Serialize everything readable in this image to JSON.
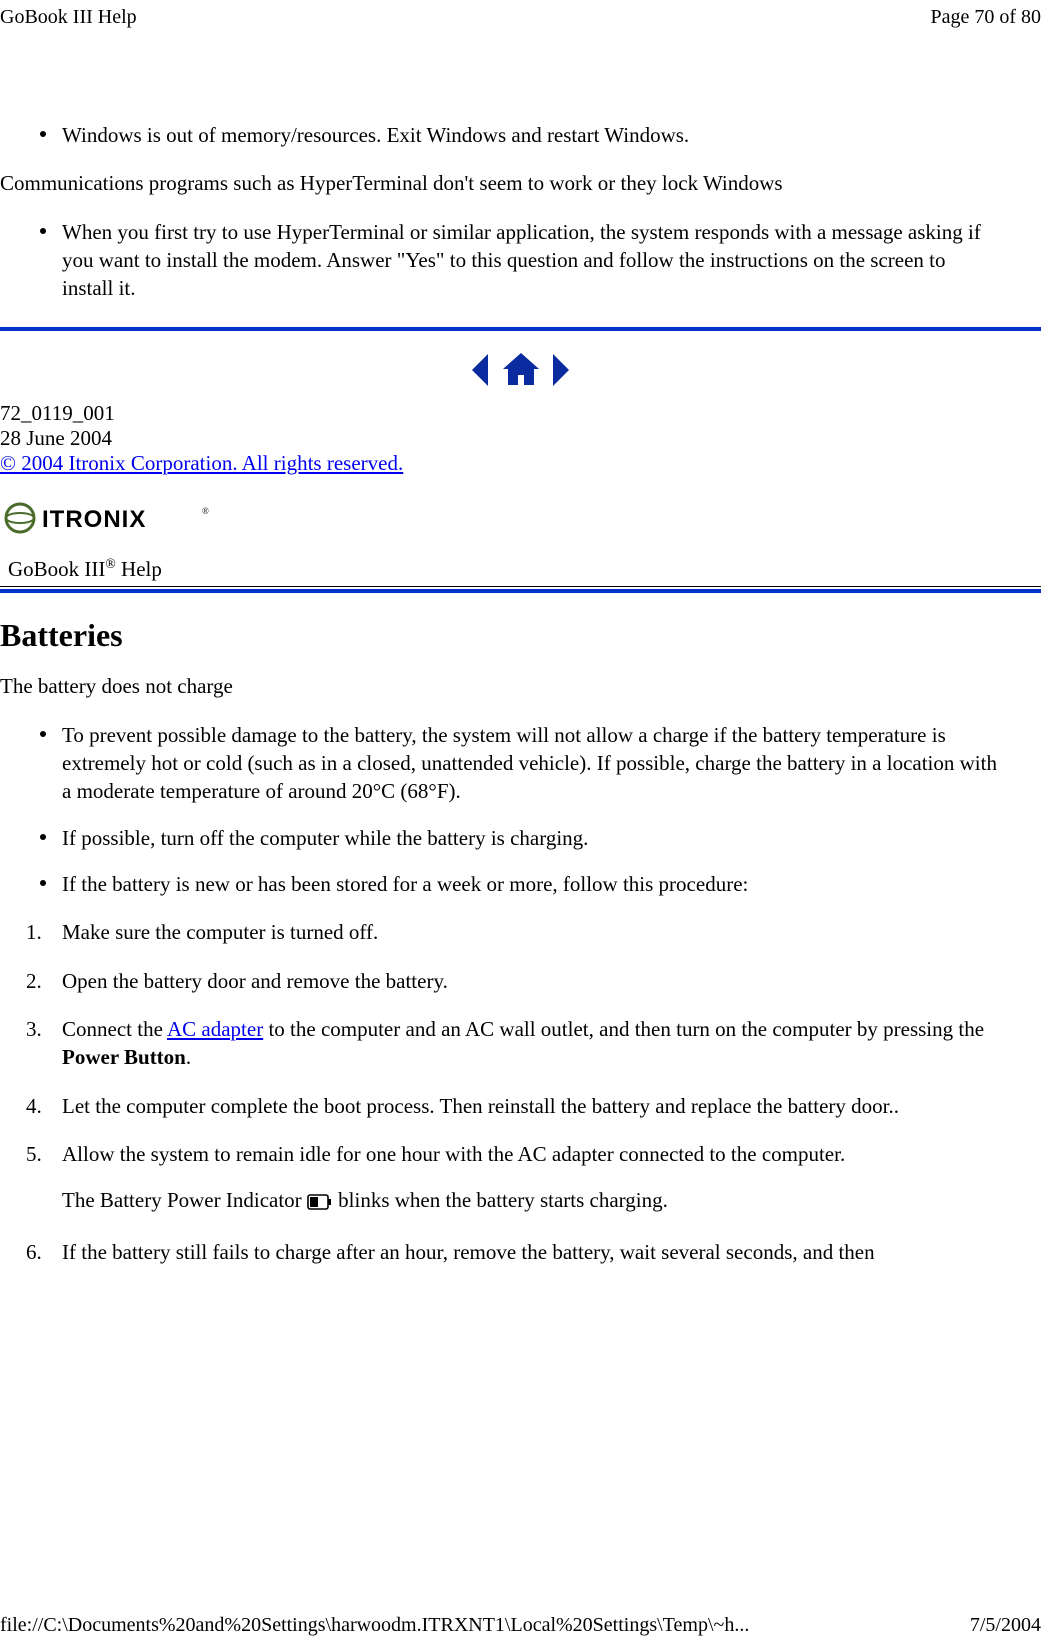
{
  "header": {
    "title": "GoBook III Help",
    "page": "Page 70 of 80"
  },
  "top_bullets": {
    "b1": "Windows is out of memory/resources. Exit Windows and restart Windows."
  },
  "comm_para": "Communications programs such as HyperTerminal don't seem to work or they lock Windows",
  "comm_bullet": "When you first try to use HyperTerminal or similar application, the system responds with a message asking if you want to install the modem. Answer \"Yes\" to this question and follow the instructions on the screen to install it.",
  "docid": "72_0119_001",
  "docdate": "28 June 2004",
  "copyright": "© 2004 Itronix Corporation.  All rights reserved.",
  "logo_text": "ITRONIX",
  "section_label_prefix": "GoBook III",
  "section_label_reg": "®",
  "section_label_suffix": " Help",
  "h2": "Batteries",
  "batt_para": "The battery does not charge",
  "batt_bullets": {
    "b1": "To prevent possible damage to the battery, the system will not allow a charge if the battery temperature is extremely hot or cold (such as in a closed, unattended vehicle). If possible, charge the battery in a location with a moderate temperature of around 20°C (68°F).",
    "b2": "If possible, turn off the computer while the battery is charging.",
    "b3": "If the battery is new or has been stored for a week or more, follow this procedure:"
  },
  "steps": {
    "s1": "Make sure the computer is turned off.",
    "s2": "Open the battery door and remove the battery.",
    "s3_pre": "Connect the ",
    "s3_link": "AC adapter",
    "s3_mid": " to the computer and an AC wall outlet, and then turn on the computer by pressing the ",
    "s3_bold": "Power Button",
    "s3_post": ".",
    "s4": "Let the computer complete the boot process.  Then reinstall the battery and replace the battery door..",
    "s5": "Allow the system to remain idle for one hour with the AC adapter connected to the computer.",
    "s5_sub_pre": "The Battery Power Indicator ",
    "s5_sub_post": " blinks when the battery starts charging.",
    "s6": "If the battery still fails to charge after an hour, remove the battery, wait several seconds, and then"
  },
  "numbers": {
    "n1": "1.",
    "n2": "2.",
    "n3": "3.",
    "n4": "4.",
    "n5": "5.",
    "n6": "6."
  },
  "footer": {
    "path": "file://C:\\Documents%20and%20Settings\\harwoodm.ITRXNT1\\Local%20Settings\\Temp\\~h...",
    "date": "7/5/2004"
  }
}
